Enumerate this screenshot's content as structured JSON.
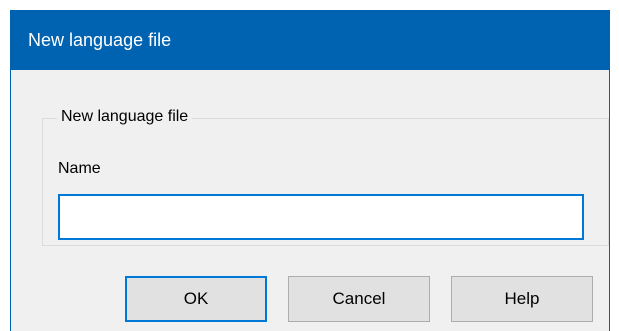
{
  "window": {
    "title": "New language file"
  },
  "group": {
    "legend": "New language file",
    "name_label": "Name",
    "name_value": "",
    "name_placeholder": ""
  },
  "buttons": {
    "ok": "OK",
    "cancel": "Cancel",
    "help": "Help"
  },
  "colors": {
    "titlebar": "#0063b1",
    "accent": "#0078d7",
    "dialog_background": "#f0f0f0",
    "button_background": "#e1e1e1"
  }
}
